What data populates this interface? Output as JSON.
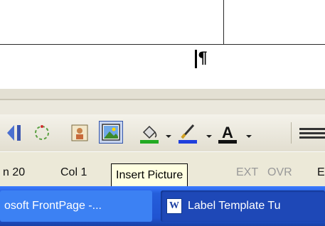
{
  "document": {
    "paragraph_mark": "¶"
  },
  "toolbar": {
    "icons": [
      {
        "name": "bullets-icon"
      },
      {
        "name": "rotate-icon"
      },
      {
        "name": "clip-art-icon"
      },
      {
        "name": "insert-picture-icon"
      },
      {
        "name": "fill-color-icon",
        "color": "#22aa22"
      },
      {
        "name": "line-color-icon",
        "color": "#1f3fdd"
      },
      {
        "name": "font-color-icon",
        "color": "#111111"
      },
      {
        "name": "line-style-icon"
      }
    ]
  },
  "status": {
    "line": "n 20",
    "col": "Col 1",
    "ext": "EXT",
    "ovr": "OVR",
    "trailing": "E"
  },
  "tooltip": {
    "text": "Insert Picture"
  },
  "taskbar": {
    "task1": "osoft FrontPage -...",
    "task2": "Label Template Tu",
    "word_icon_letter": "W"
  }
}
